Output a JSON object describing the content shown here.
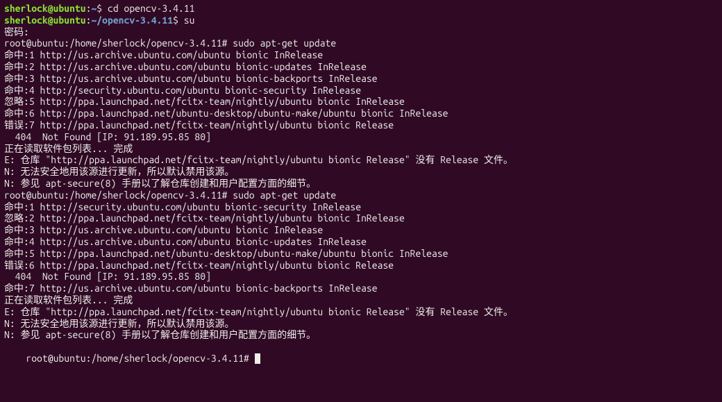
{
  "prompt1": {
    "userhost": "sherlock@ubuntu",
    "sep": ":",
    "path": "~",
    "dollar": "$ ",
    "cmd": "cd opencv-3.4.11"
  },
  "prompt2": {
    "userhost": "sherlock@ubuntu",
    "sep": ":",
    "path": "~/opencv-3.4.11",
    "dollar": "$ ",
    "cmd": "su"
  },
  "lines": [
    "密码:",
    "root@ubuntu:/home/sherlock/opencv-3.4.11# sudo apt-get update",
    "命中:1 http://us.archive.ubuntu.com/ubuntu bionic InRelease",
    "命中:2 http://us.archive.ubuntu.com/ubuntu bionic-updates InRelease",
    "命中:3 http://us.archive.ubuntu.com/ubuntu bionic-backports InRelease",
    "命中:4 http://security.ubuntu.com/ubuntu bionic-security InRelease",
    "忽略:5 http://ppa.launchpad.net/fcitx-team/nightly/ubuntu bionic InRelease",
    "命中:6 http://ppa.launchpad.net/ubuntu-desktop/ubuntu-make/ubuntu bionic InRelease",
    "错误:7 http://ppa.launchpad.net/fcitx-team/nightly/ubuntu bionic Release",
    "  404  Not Found [IP: 91.189.95.85 80]",
    "正在读取软件包列表... 完成",
    "E: 仓库 \"http://ppa.launchpad.net/fcitx-team/nightly/ubuntu bionic Release\" 没有 Release 文件。",
    "N: 无法安全地用该源进行更新，所以默认禁用该源。",
    "N: 参见 apt-secure(8) 手册以了解仓库创建和用户配置方面的细节。",
    "root@ubuntu:/home/sherlock/opencv-3.4.11# sudo apt-get update",
    "命中:1 http://security.ubuntu.com/ubuntu bionic-security InRelease",
    "忽略:2 http://ppa.launchpad.net/fcitx-team/nightly/ubuntu bionic InRelease",
    "命中:3 http://us.archive.ubuntu.com/ubuntu bionic InRelease",
    "命中:4 http://us.archive.ubuntu.com/ubuntu bionic-updates InRelease",
    "命中:5 http://ppa.launchpad.net/ubuntu-desktop/ubuntu-make/ubuntu bionic InRelease",
    "错误:6 http://ppa.launchpad.net/fcitx-team/nightly/ubuntu bionic Release",
    "  404  Not Found [IP: 91.189.95.85 80]",
    "命中:7 http://us.archive.ubuntu.com/ubuntu bionic-backports InRelease",
    "正在读取软件包列表... 完成",
    "E: 仓库 \"http://ppa.launchpad.net/fcitx-team/nightly/ubuntu bionic Release\" 没有 Release 文件。",
    "N: 无法安全地用该源进行更新，所以默认禁用该源。",
    "N: 参见 apt-secure(8) 手册以了解仓库创建和用户配置方面的细节。"
  ],
  "finalPrompt": "root@ubuntu:/home/sherlock/opencv-3.4.11# "
}
